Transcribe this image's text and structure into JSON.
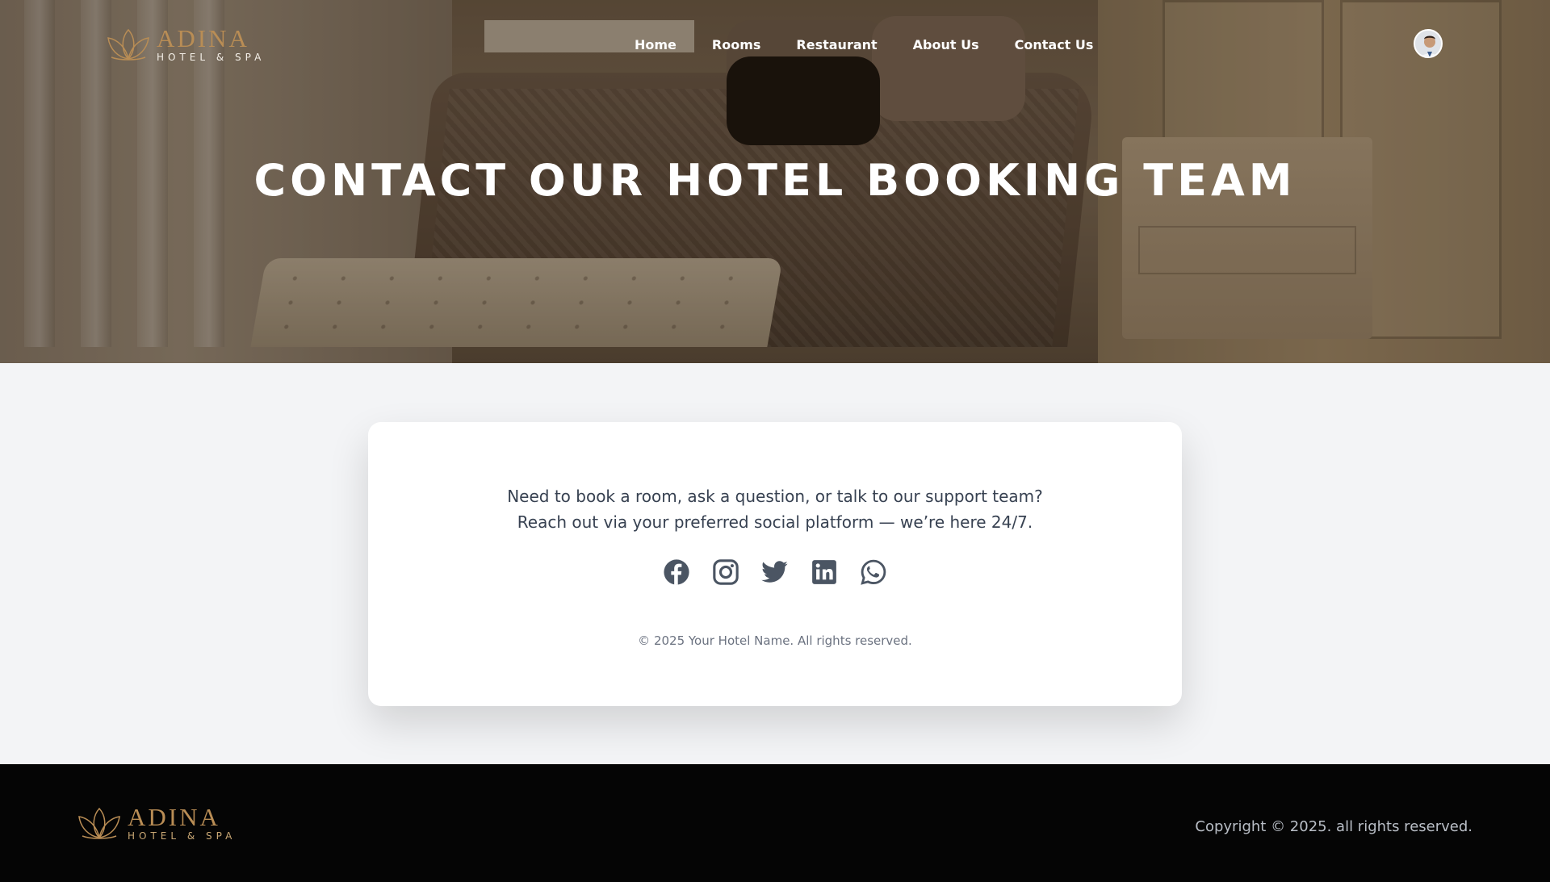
{
  "header": {
    "logo": {
      "brand": "ADINA",
      "tagline": "HOTEL & SPA"
    },
    "nav": [
      {
        "label": "Home"
      },
      {
        "label": "Rooms"
      },
      {
        "label": "Restaurant"
      },
      {
        "label": "About Us"
      },
      {
        "label": "Contact Us"
      }
    ],
    "avatar_icon": "user-avatar"
  },
  "hero": {
    "title": "CONTACT OUR HOTEL BOOKING TEAM"
  },
  "card": {
    "line1": "Need to book a room, ask a question, or talk to our support team?",
    "line2": "Reach out via your preferred social platform — we’re here 24/7.",
    "socials": [
      {
        "icon": "facebook-icon"
      },
      {
        "icon": "instagram-icon"
      },
      {
        "icon": "twitter-icon"
      },
      {
        "icon": "linkedin-icon"
      },
      {
        "icon": "whatsapp-icon"
      }
    ],
    "copyright": "© 2025 Your Hotel Name. All rights reserved."
  },
  "footer": {
    "logo": {
      "brand": "ADINA",
      "tagline": "HOTEL & SPA"
    },
    "copyright": "Copyright © 2025. all rights reserved."
  },
  "colors": {
    "brand_gold": "#b98d55",
    "icon_gray": "#4b5563",
    "footer_bg": "#050505",
    "page_bg": "#f3f4f6"
  }
}
